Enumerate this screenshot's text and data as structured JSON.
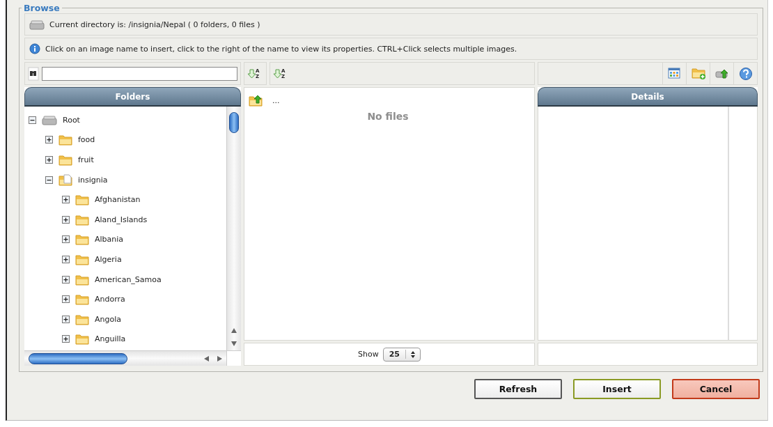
{
  "section": {
    "legend": "Browse"
  },
  "directory": {
    "text": "Current directory is: /insignia/Nepal ( 0 folders, 0 files )"
  },
  "info": {
    "text": "Click on an image name to insert, click to the right of the name to view its properties. CTRL+Click selects multiple images."
  },
  "sort_buttons": [
    {
      "top": "A",
      "bottom": "Z"
    },
    {
      "top": "A",
      "bottom": "Z"
    }
  ],
  "folders_panel": {
    "title": "Folders",
    "tree": [
      {
        "label": "Root",
        "kind": "drive",
        "expanded": true,
        "children": [
          {
            "label": "food",
            "kind": "folder",
            "expanded": false
          },
          {
            "label": "fruit",
            "kind": "folder",
            "expanded": false
          },
          {
            "label": "insignia",
            "kind": "folder_page",
            "expanded": true,
            "children": [
              {
                "label": "Afghanistan",
                "kind": "folder",
                "expanded": false
              },
              {
                "label": "Aland_Islands",
                "kind": "folder",
                "expanded": false
              },
              {
                "label": "Albania",
                "kind": "folder",
                "expanded": false
              },
              {
                "label": "Algeria",
                "kind": "folder",
                "expanded": false
              },
              {
                "label": "American_Samoa",
                "kind": "folder",
                "expanded": false
              },
              {
                "label": "Andorra",
                "kind": "folder",
                "expanded": false
              },
              {
                "label": "Angola",
                "kind": "folder",
                "expanded": false
              },
              {
                "label": "Anguilla",
                "kind": "folder",
                "expanded": false
              }
            ]
          }
        ]
      }
    ]
  },
  "files_panel": {
    "items": [
      {
        "label": "...",
        "kind": "parent"
      }
    ],
    "empty_text": "No files"
  },
  "details_panel": {
    "title": "Details"
  },
  "pager": {
    "label": "Show",
    "value": "25"
  },
  "buttons": [
    {
      "label": "Refresh",
      "kind": "neutral"
    },
    {
      "label": "Insert",
      "kind": "confirm"
    },
    {
      "label": "Cancel",
      "kind": "cancel"
    }
  ]
}
